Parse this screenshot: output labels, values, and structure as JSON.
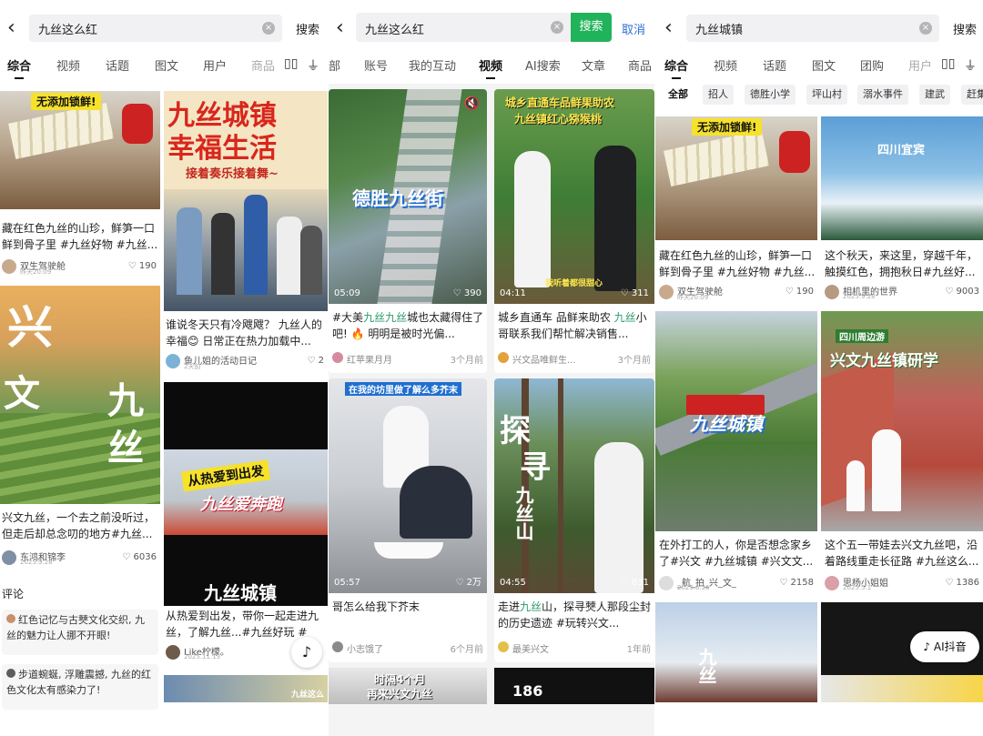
{
  "panel1": {
    "query": "九丝这么红",
    "search_label": "搜索",
    "tabs": [
      "综合",
      "视频",
      "话题",
      "图文",
      "用户",
      "商品"
    ],
    "card1": {
      "banner": "无添加锁鲜!",
      "caption": "藏在红色九丝的山珍，鲜笋一口鲜到骨子里 #九丝好物 #九丝...",
      "author": "双生驾驶舱",
      "date": "昨天20:09",
      "likes": "190"
    },
    "card2": {
      "title1": "九丝城镇",
      "title2": "幸福生活",
      "sub": "接着奏乐接着舞~",
      "caption": "谁说冬天只有冷飕飕？ 九丝人的幸福😊 日常正在热力加载中...",
      "author": "鱼儿姐的活动日记",
      "date": "2天前",
      "likes": "2"
    },
    "card3": {
      "big1": "兴",
      "big2": "文",
      "big3": "九",
      "big4": "丝",
      "caption": "兴文九丝，一个去之前没听过，但走后却总念叨的地方#九丝...",
      "author": "东鸿和锦李",
      "date": "2025.9.28",
      "likes": "6036"
    },
    "card4": {
      "ov1": "从热爱到出发",
      "ov2": "九丝爱奔跑",
      "ov3": "九丝城镇",
      "caption": "从热爱到出发，带你一起走进九丝，了解九丝...#九丝好玩 #九...",
      "author": "Like柠檬。",
      "date": "2025.11.13"
    },
    "comments_title": "评论",
    "comments": [
      "红色记忆与古僰文化交织, 九丝的魅力让人挪不开眼!",
      "步道蜿蜒, 浮雕震撼, 九丝的红色文化太有感染力了!"
    ],
    "bottom_snip": "九丝这么"
  },
  "panel2": {
    "query": "九丝这么红",
    "search_label": "搜索",
    "cancel_label": "取消",
    "tabs": [
      "部",
      "账号",
      "我的互动",
      "视频",
      "AI搜索",
      "文章",
      "商品"
    ],
    "card1": {
      "ov": "德胜九丝街",
      "dur": "05:09",
      "likes": "390",
      "cap_a": "#大美",
      "cap_hl": "九丝九丝",
      "cap_b": "城也太藏得住了吧! 🔥 明明是被时光偏...",
      "author": "红苹果月月",
      "time": "3个月前"
    },
    "card2": {
      "ov1": "城乡直通车品鲜果助农",
      "ov2": "九丝镇红心猕猴桃",
      "ov3": "我听着都很甜心",
      "dur": "04:11",
      "likes": "311",
      "cap_a": "城乡直通车 品鲜来助农 ",
      "cap_hl": "九丝",
      "cap_b": "小哥联系我们帮忙解决销售...",
      "author": "兴文品唯鲜生...",
      "time": "3个月前"
    },
    "card3": {
      "ov": "在我的坊里做了解么多芥末",
      "dur": "05:57",
      "likes": "2万",
      "caption": "哥怎么给我下芥末",
      "author": "小志饿了",
      "time": "6个月前"
    },
    "card4": {
      "ov1": "探",
      "ov2": "寻",
      "ov3": "九丝山",
      "dur": "04:55",
      "likes": "831",
      "cap_a": "走进",
      "cap_hl": "九丝",
      "cap_b": "山，探寻僰人那段尘封的历史遗迹 #玩转兴文...",
      "author": "最美兴文",
      "time": "1年前"
    },
    "bottom1": "时隔4个月",
    "bottom2": "再来兴文九丝",
    "bottom3": "186"
  },
  "panel3": {
    "query": "九丝城镇",
    "search_label": "搜索",
    "tabs": [
      "综合",
      "视频",
      "话题",
      "图文",
      "团购",
      "用户"
    ],
    "chips": [
      "全部",
      "招人",
      "德胜小学",
      "坪山村",
      "溺水事件",
      "建武",
      "赶集"
    ],
    "card1": {
      "banner": "无添加锁鲜!",
      "caption": "藏在红色九丝的山珍，鲜笋一口鲜到骨子里 #九丝好物 #九丝...",
      "author": "双生驾驶舱",
      "date": "昨天20:09",
      "likes": "190"
    },
    "card2": {
      "title": "四川宜宾",
      "caption": "这个秋天，来这里，穿越千年，触摸红色，拥抱秋日#九丝好...",
      "author": "相机里的世界",
      "date": "2025.9.28",
      "likes": "9003"
    },
    "card3": {
      "ov": "九丝城镇",
      "caption": "在外打工的人，你是否想念家乡了#兴文 #九丝城镇 #兴文文...",
      "author": "_航_拍_兴_文_",
      "date": "2025.6.26",
      "likes": "2158"
    },
    "card4": {
      "tag": "四川周边游",
      "ov": "兴文九丝镇研学",
      "caption": "这个五一带娃去兴文九丝吧，沿着路线重走长征路 #九丝这么...",
      "author": "思杨小姐姐",
      "date": "2025.5.1",
      "likes": "1386"
    },
    "bottom_ov": "九丝",
    "ai_label": "AI抖音"
  }
}
